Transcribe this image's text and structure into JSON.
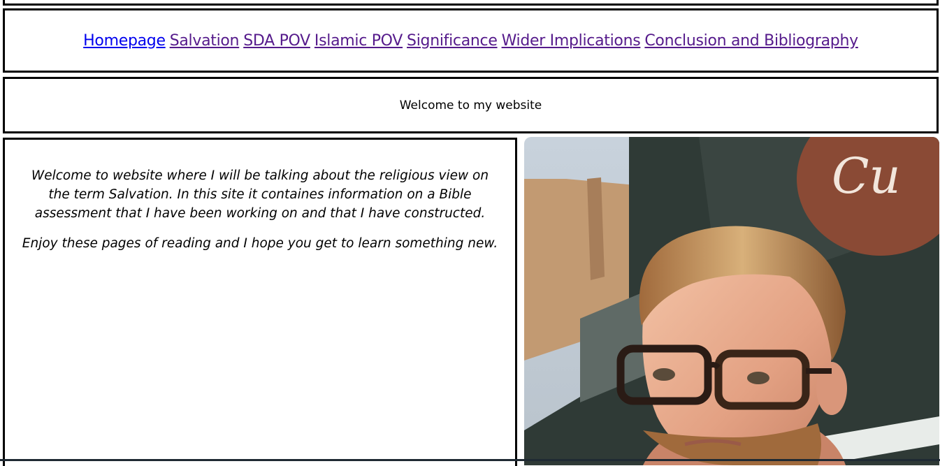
{
  "nav": {
    "links": [
      {
        "label": "Homepage",
        "current": true
      },
      {
        "label": "Salvation"
      },
      {
        "label": "SDA POV"
      },
      {
        "label": "Islamic POV"
      },
      {
        "label": "Significance"
      },
      {
        "label": "Wider Implications"
      },
      {
        "label": "Conclusion and Bibliography"
      }
    ]
  },
  "header": {
    "welcome": "Welcome to my website"
  },
  "main": {
    "paragraphs": [
      "Welcome to website where I will be talking about the religious view on the term Salvation. In this site it containes information on a Bible assessment that I have been working on and that I have constructed.",
      "Enjoy these pages of reading and I hope you get to learn something new."
    ]
  },
  "colors": {
    "visited_link": "#551a8b",
    "active_link": "#0000ee",
    "border": "#000000"
  }
}
